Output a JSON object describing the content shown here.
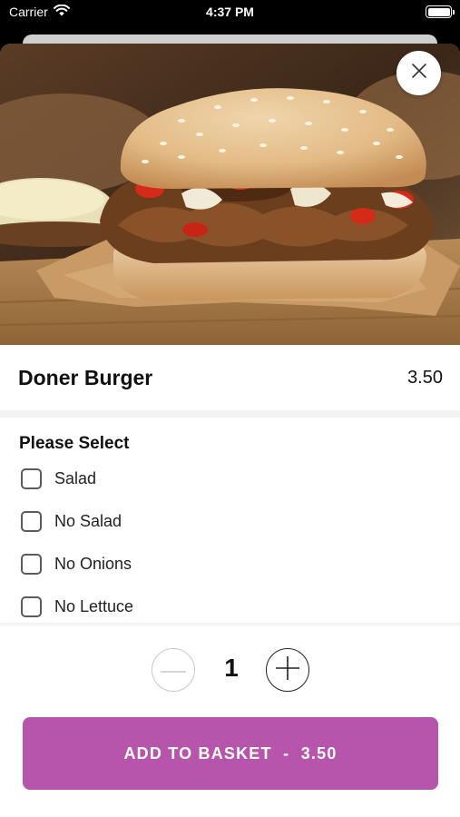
{
  "status_bar": {
    "carrier": "Carrier",
    "time": "4:37 PM",
    "icons": [
      "wifi-icon",
      "battery-icon"
    ]
  },
  "product": {
    "name": "Doner Burger",
    "price": "3.50",
    "image": "doner-burger-photo"
  },
  "options": {
    "heading": "Please Select",
    "items": [
      {
        "label": "Salad",
        "checked": false
      },
      {
        "label": "No Salad",
        "checked": false
      },
      {
        "label": "No Onions",
        "checked": false
      },
      {
        "label": "No Lettuce",
        "checked": false
      }
    ]
  },
  "quantity": {
    "value": "1",
    "icons": [
      "minus-icon",
      "plus-icon"
    ]
  },
  "add_button": {
    "label": "ADD TO BASKET  -  3.50"
  },
  "colors": {
    "accent": "#b755ad",
    "minus_border": "#c9c9c9"
  }
}
